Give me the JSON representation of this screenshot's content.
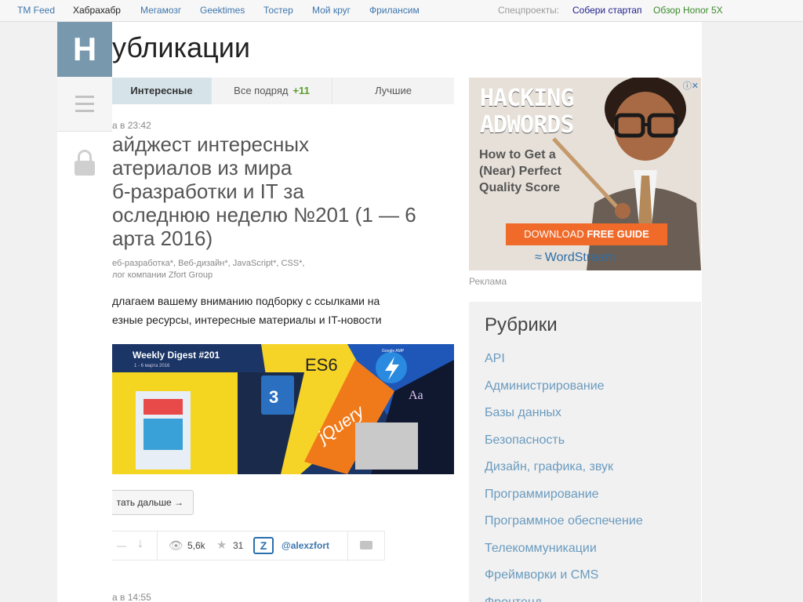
{
  "topnav": {
    "links": [
      "TM Feed",
      "Хабрахабр",
      "Мегамозг",
      "Geektimes",
      "Тостер",
      "Мой круг",
      "Фрилансим"
    ],
    "special_label": "Спецпроекты:",
    "special_links": [
      "Собери стартап",
      "Обзор Honor 5X"
    ]
  },
  "sidebar": {
    "logo": "H"
  },
  "page": {
    "title": "убликации"
  },
  "tabs": [
    {
      "label": "Интересные"
    },
    {
      "label": "Все подряд",
      "badge": "+11"
    },
    {
      "label": "Лучшие"
    }
  ],
  "post": {
    "time": "а в 23:42",
    "title": "айджест интересных атериалов из мира б-разработки и IT за оследнюю неделю №201 (1 — 6 арта 2016)",
    "title_lines": [
      "айджест интересных",
      "атериалов из мира",
      "б-разработки и IT за",
      "оследнюю неделю №201 (1 — 6",
      "арта 2016)"
    ],
    "hubs_line1": "еб-разработка*, Веб-дизайн*, JavaScript*, CSS*,",
    "hubs_line2": "лог компании Zfort Group",
    "text_line1": "длагаем вашему вниманию подборку с ссылками на",
    "text_line2": "езные ресурсы, интересные материалы и IT-новости",
    "banner": {
      "title": "Weekly Digest  #201",
      "date": "1 - 6 марта 2016",
      "es6": "ES6",
      "jquery": "jQuery",
      "amp": "Google AMP",
      "aa": "Aa"
    },
    "read_more": "тать дальше →",
    "views": "5,6k",
    "favorites": "31",
    "author": "@alexzfort",
    "vote": "—"
  },
  "post2": {
    "time": "а в 14:55"
  },
  "ad": {
    "heading_line1": "HACKING",
    "heading_line2": "ADWORDS",
    "sub": "How to Get a (Near) Perfect Quality Score",
    "cta_prefix": "DOWNLOAD ",
    "cta_bold": "FREE GUIDE",
    "brand": "WordStream",
    "label": "Реклама"
  },
  "rubrics": {
    "title": "Рубрики",
    "items": [
      "API",
      "Администрирование",
      "Базы данных",
      "Безопасность",
      "Дизайн, графика, звук",
      "Программирование",
      "Программное обеспечение",
      "Телекоммуникации",
      "Фреймворки и CMS",
      "Фронтенд"
    ]
  },
  "colors": {
    "link": "#3e76ad",
    "logo_bg": "#7898ae",
    "accent_green": "#5b9e2b",
    "ad_cta": "#f06a2a"
  }
}
